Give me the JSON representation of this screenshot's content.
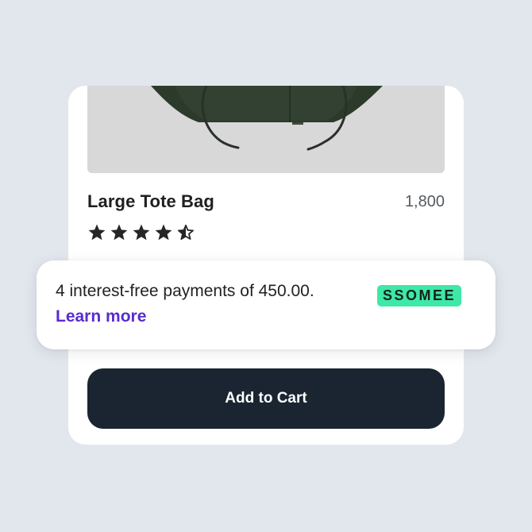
{
  "product": {
    "name": "Large Tote Bag",
    "price": "1,800",
    "rating": 4.5,
    "max_rating": 5,
    "image_icon": "tote-bag-image"
  },
  "payment": {
    "message": "4 interest-free payments of 450.00.",
    "link_label": "Learn more",
    "badge_label": "SSOMEE"
  },
  "actions": {
    "add_to_cart_label": "Add to Cart"
  },
  "colors": {
    "page_background": "#e2e7ed",
    "button_background": "#1a2531",
    "link": "#5a2bd0",
    "badge": "#3ee8a6"
  }
}
